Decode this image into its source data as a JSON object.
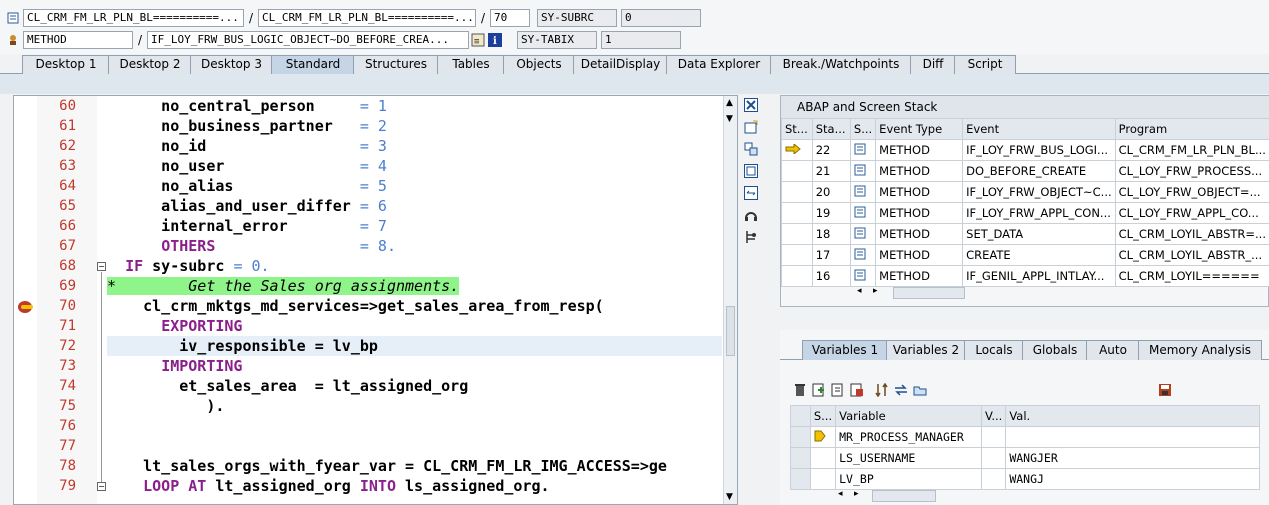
{
  "header": {
    "program_main": "CL_CRM_FM_LR_PLN_BL==========...",
    "program_include": "CL_CRM_FM_LR_PLN_BL==========...",
    "line_number": "70",
    "subrc_label": "SY-SUBRC",
    "subrc_value": "0",
    "event_type": "METHOD",
    "event_name": "IF_LOY_FRW_BUS_LOGIC_OBJECT~DO_BEFORE_CREA...",
    "tabix_label": "SY-TABIX",
    "tabix_value": "1"
  },
  "tabs": [
    "Desktop 1",
    "Desktop 2",
    "Desktop 3",
    "Standard",
    "Structures",
    "Tables",
    "Objects",
    "DetailDisplay",
    "Data Explorer",
    "Break./Watchpoints",
    "Diff",
    "Script"
  ],
  "editor": {
    "lines": [
      {
        "n": "60",
        "code": "      no_central_person     = 1"
      },
      {
        "n": "61",
        "code": "      no_business_partner   = 2"
      },
      {
        "n": "62",
        "code": "      no_id                 = 3"
      },
      {
        "n": "63",
        "code": "      no_user               = 4"
      },
      {
        "n": "64",
        "code": "      no_alias              = 5"
      },
      {
        "n": "65",
        "code": "      alias_and_user_differ = 6"
      },
      {
        "n": "66",
        "code": "      internal_error        = 7"
      },
      {
        "n": "67",
        "code": "      OTHERS                = 8."
      },
      {
        "n": "68",
        "code": "  IF sy-subrc = 0."
      },
      {
        "n": "69",
        "code": "*        Get the Sales org assignments."
      },
      {
        "n": "70",
        "code": "    cl_crm_mktgs_md_services=>get_sales_area_from_resp("
      },
      {
        "n": "71",
        "code": "      EXPORTING"
      },
      {
        "n": "72",
        "code": "        iv_responsible = lv_bp"
      },
      {
        "n": "73",
        "code": "      IMPORTING"
      },
      {
        "n": "74",
        "code": "        et_sales_area  = lt_assigned_org"
      },
      {
        "n": "75",
        "code": "           )."
      },
      {
        "n": "76",
        "code": ""
      },
      {
        "n": "77",
        "code": ""
      },
      {
        "n": "78",
        "code": "    lt_sales_orgs_with_fyear_var = CL_CRM_FM_LR_IMG_ACCESS=>ge"
      },
      {
        "n": "79",
        "code": "    LOOP AT lt_assigned_org INTO ls_assigned_org."
      }
    ]
  },
  "stack": {
    "title": "ABAP and Screen Stack",
    "columns": [
      "St...",
      "Sta...",
      "S...",
      "Event Type",
      "Event",
      "Program"
    ],
    "rows": [
      {
        "level": "22",
        "etype": "METHOD",
        "event": "IF_LOY_FRW_BUS_LOGI...",
        "program": "CL_CRM_FM_LR_PLN_BL..."
      },
      {
        "level": "21",
        "etype": "METHOD",
        "event": "DO_BEFORE_CREATE",
        "program": "CL_LOY_FRW_PROCESS..."
      },
      {
        "level": "20",
        "etype": "METHOD",
        "event": "IF_LOY_FRW_OBJECT~C...",
        "program": "CL_LOY_FRW_OBJECT=..."
      },
      {
        "level": "19",
        "etype": "METHOD",
        "event": "IF_LOY_FRW_APPL_CON...",
        "program": "CL_LOY_FRW_APPL_CO..."
      },
      {
        "level": "18",
        "etype": "METHOD",
        "event": "SET_DATA",
        "program": "CL_CRM_LOYIL_ABSTR=..."
      },
      {
        "level": "17",
        "etype": "METHOD",
        "event": "CREATE",
        "program": "CL_CRM_LOYIL_ABSTR_..."
      },
      {
        "level": "16",
        "etype": "METHOD",
        "event": "IF_GENIL_APPL_INTLAY...",
        "program": "CL_CRM_LOYIL======"
      }
    ]
  },
  "var_tabs": [
    "Variables 1",
    "Variables 2",
    "Locals",
    "Globals",
    "Auto",
    "Memory Analysis"
  ],
  "variables": {
    "columns": [
      "S...",
      "Variable",
      "V...",
      "Val."
    ],
    "rows": [
      {
        "name": "MR_PROCESS_MANAGER",
        "value": ""
      },
      {
        "name": "LS_USERNAME",
        "value": "WANGJER"
      },
      {
        "name": "LV_BP",
        "value": "WANGJ"
      }
    ]
  },
  "colors": {
    "line_number": "#c0392b",
    "keyword": "#8b1f8b",
    "number": "#4a7fd0",
    "comment_bg": "#8ff58a",
    "active_tab": "#c6d5e6"
  }
}
